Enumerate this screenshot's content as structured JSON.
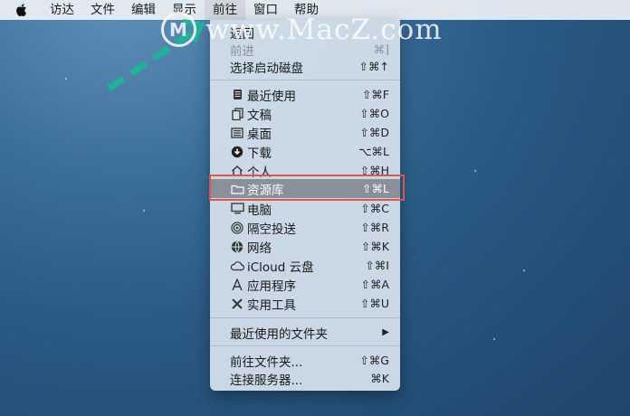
{
  "menubar": {
    "items": [
      "访达",
      "文件",
      "编辑",
      "显示",
      "前往",
      "窗口",
      "帮助"
    ],
    "active_index": 4
  },
  "watermark": {
    "logo_letter": "M",
    "text": "www.MacZ.com"
  },
  "menu": {
    "items": [
      {
        "label": "返回",
        "shortcut": "",
        "icon": "",
        "disabled": false
      },
      {
        "label": "前进",
        "shortcut": "⌘]",
        "icon": "",
        "disabled": true
      },
      {
        "label": "选择启动磁盘",
        "shortcut": "⇧⌘↑",
        "icon": "",
        "disabled": false
      },
      {
        "label": "最近使用",
        "shortcut": "⇧⌘F",
        "icon": "recents-icon"
      },
      {
        "label": "文稿",
        "shortcut": "⇧⌘O",
        "icon": "documents-icon"
      },
      {
        "label": "桌面",
        "shortcut": "⇧⌘D",
        "icon": "desktop-icon"
      },
      {
        "label": "下载",
        "shortcut": "⌥⌘L",
        "icon": "downloads-icon"
      },
      {
        "label": "个人",
        "shortcut": "⇧⌘H",
        "icon": "home-icon"
      },
      {
        "label": "资源库",
        "shortcut": "⇧⌘L",
        "icon": "folder-icon",
        "highlighted": true
      },
      {
        "label": "电脑",
        "shortcut": "⇧⌘C",
        "icon": "computer-icon"
      },
      {
        "label": "隔空投送",
        "shortcut": "⇧⌘R",
        "icon": "airdrop-icon"
      },
      {
        "label": "网络",
        "shortcut": "⇧⌘K",
        "icon": "network-icon"
      },
      {
        "label": "iCloud 云盘",
        "shortcut": "⇧⌘I",
        "icon": "cloud-icon"
      },
      {
        "label": "应用程序",
        "shortcut": "⇧⌘A",
        "icon": "applications-icon"
      },
      {
        "label": "实用工具",
        "shortcut": "⇧⌘U",
        "icon": "utilities-icon"
      },
      {
        "label": "最近使用的文件夹",
        "shortcut": "▶",
        "icon": ""
      },
      {
        "label": "前往文件夹...",
        "shortcut": "⇧⌘G",
        "icon": ""
      },
      {
        "label": "连接服务器...",
        "shortcut": "⌘K",
        "icon": ""
      }
    ]
  },
  "colors": {
    "highlight": "#8a9099",
    "annotation_box": "#e0554a",
    "arrow": "#1fb39a"
  }
}
